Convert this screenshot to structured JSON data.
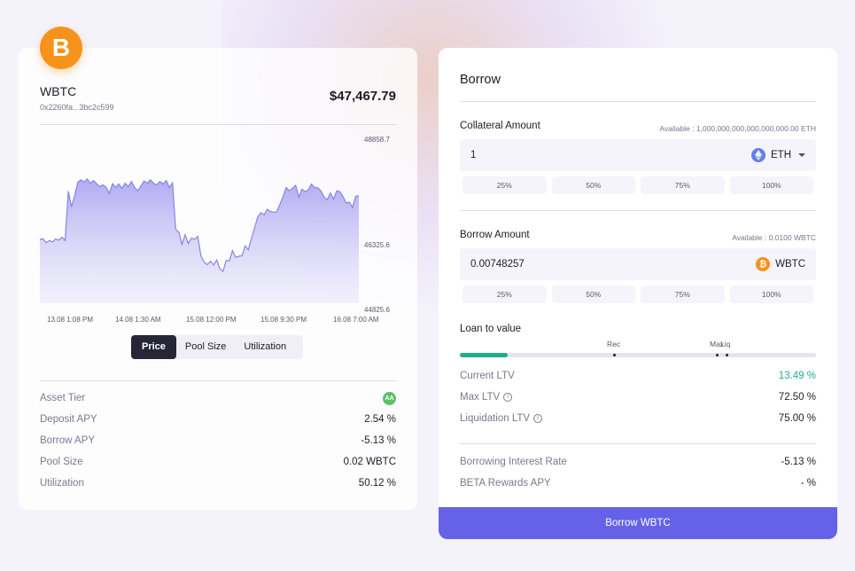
{
  "asset": {
    "logo_glyph": "B",
    "name": "WBTC",
    "address": "0x2260fa...3bc2c599",
    "price": "$47,467.79",
    "brand_color": "#f7931a"
  },
  "chart_data": {
    "type": "area",
    "y_ticks": [
      "48858.7",
      "46325.6",
      "44825.6"
    ],
    "x_ticks": [
      "13.08 1:08 PM",
      "14.08 1:30 AM",
      "15.08 12:00 PM",
      "15.08 9:30 PM",
      "16.08 7:00 AM"
    ],
    "ylim": [
      44825.6,
      48858.7
    ],
    "values": [
      46550,
      46560,
      46470,
      46520,
      46490,
      46560,
      46530,
      46600,
      46520,
      47690,
      47320,
      47580,
      47900,
      47960,
      47900,
      47980,
      47880,
      47940,
      47860,
      47800,
      47840,
      47780,
      47640,
      47870,
      47780,
      47860,
      47760,
      47880,
      47800,
      47920,
      47780,
      47700,
      47820,
      47930,
      47880,
      47960,
      47880,
      47840,
      47920,
      47860,
      47940,
      47780,
      47890,
      46790,
      46720,
      46430,
      46660,
      46450,
      46580,
      46550,
      46620,
      46160,
      46010,
      45950,
      46030,
      45940,
      46060,
      45850,
      45790,
      46050,
      46040,
      46280,
      46120,
      46150,
      46160,
      46390,
      46300,
      46570,
      46820,
      47080,
      47180,
      47130,
      47260,
      47210,
      47190,
      47200,
      47380,
      47560,
      47780,
      47700,
      47760,
      47830,
      47550,
      47740,
      47680,
      47720,
      47860,
      47780,
      47770,
      47700,
      47550,
      47490,
      47650,
      47500,
      47700,
      47680,
      47560,
      47410,
      47430,
      47300,
      47570,
      47580
    ],
    "line_color": "#8a83e6"
  },
  "chart_tabs": [
    {
      "label": "Price",
      "active": true
    },
    {
      "label": "Pool Size",
      "active": false
    },
    {
      "label": "Utilization",
      "active": false
    }
  ],
  "stats": {
    "asset_tier_label": "Asset Tier",
    "asset_tier_badge": "AA",
    "deposit_apy_label": "Deposit APY",
    "deposit_apy_value": "2.54 %",
    "borrow_apy_label": "Borrow APY",
    "borrow_apy_value": "-5.13 %",
    "pool_size_label": "Pool Size",
    "pool_size_value": "0.02 WBTC",
    "utilization_label": "Utilization",
    "utilization_value": "50.12 %"
  },
  "borrow": {
    "title": "Borrow",
    "collateral_label": "Collateral Amount",
    "collateral_available": "Available : 1,000,000,000,000,000,000.00 ETH",
    "collateral_value": "1",
    "collateral_token": "ETH",
    "collateral_token_icon": "eth-icon",
    "collateral_pcts": [
      "25%",
      "50%",
      "75%",
      "100%"
    ],
    "borrow_label": "Borrow Amount",
    "borrow_available": "Available : 0.0100 WBTC",
    "borrow_value": "0.00748257",
    "borrow_token": "WBTC",
    "borrow_token_icon": "btc-icon",
    "borrow_pcts": [
      "25%",
      "50%",
      "75%",
      "100%"
    ],
    "ltv_label": "Loan to value",
    "ltv_current_fraction": 0.1349,
    "ltv_markers": {
      "rec": "Rec",
      "max": "Max",
      "liq": "Liq"
    },
    "current_ltv_label": "Current LTV",
    "current_ltv_value": "13.49 %",
    "max_ltv_label": "Max LTV",
    "max_ltv_value": "72.50 %",
    "liq_ltv_label": "Liquidation LTV",
    "liq_ltv_value": "75.00 %",
    "interest_label": "Borrowing Interest Rate",
    "interest_value": "-5.13 %",
    "rewards_label": "BETA Rewards APY",
    "rewards_value": "- %",
    "button_label": "Borrow WBTC",
    "accent_green": "#1fae86",
    "button_color": "#6562e8"
  }
}
